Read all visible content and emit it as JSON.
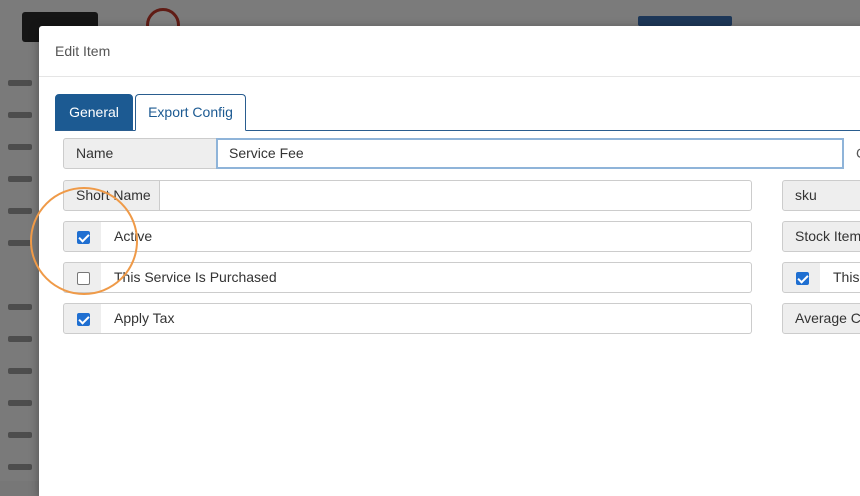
{
  "modal": {
    "title": "Edit Item"
  },
  "tabs": [
    {
      "label": "General",
      "active": true
    },
    {
      "label": "Export Config",
      "active": false
    }
  ],
  "form": {
    "name": {
      "label": "Name",
      "value": "Service Fee",
      "trailing": "C"
    },
    "short_name": {
      "label": "Short Name",
      "value": ""
    },
    "active": {
      "label": "Active",
      "checked": true
    },
    "purchased": {
      "label": "This Service Is Purchased",
      "checked": false
    },
    "apply_tax": {
      "label": "Apply Tax",
      "checked": true
    }
  },
  "right_column": {
    "sku": {
      "label": "sku"
    },
    "stock_item": {
      "label": "Stock Item"
    },
    "this_check": {
      "label": "This",
      "checked": true
    },
    "average_cost": {
      "label": "Average Co"
    }
  },
  "colors": {
    "primary": "#1c5a92",
    "checkbox": "#1f6fd1",
    "highlight_ring": "#ef9a48",
    "focus_border": "#8fb4d9"
  }
}
